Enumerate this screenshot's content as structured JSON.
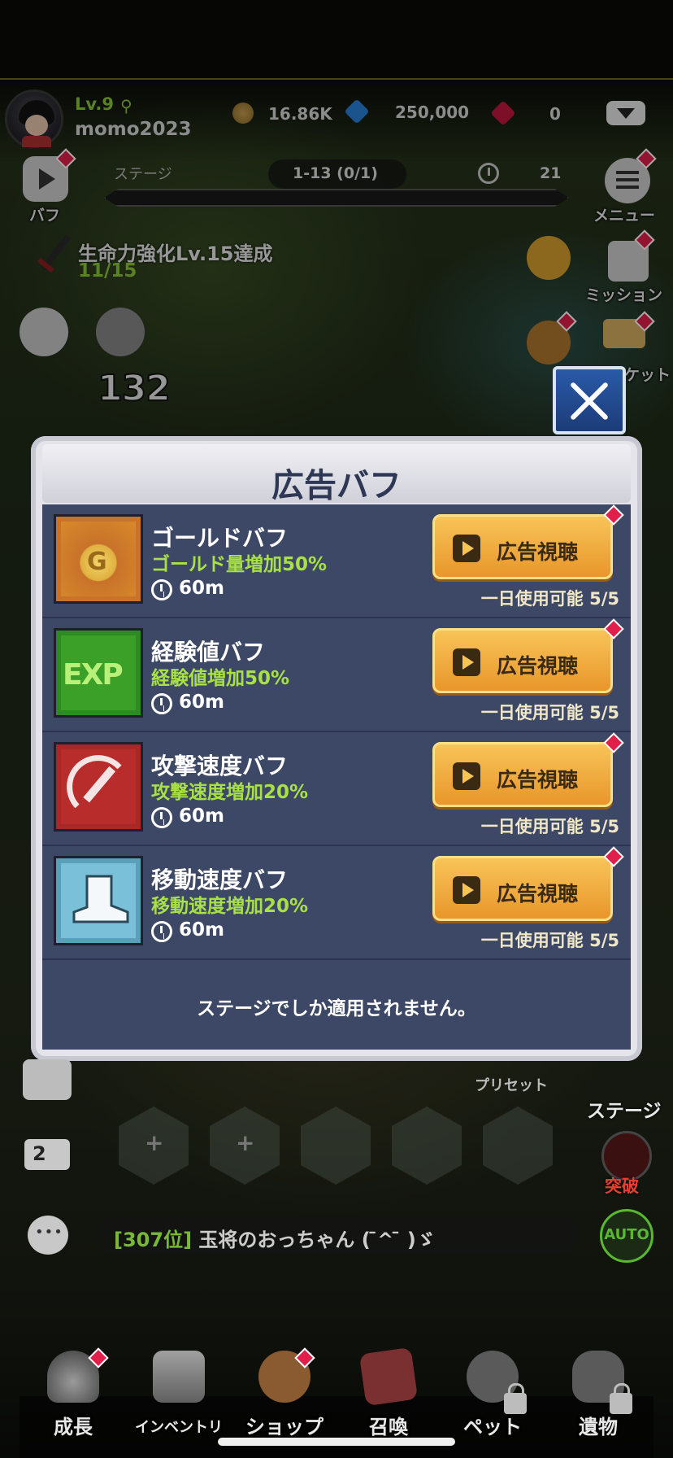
{
  "player": {
    "level": "Lv.9",
    "name": "momo2023"
  },
  "currency": {
    "gold": "16.86K",
    "diamonds": "250,000",
    "rubies": "0"
  },
  "left_menu": {
    "buff_label": "バフ"
  },
  "right_menu": {
    "menu_label": "メニュー",
    "mission_label": "ミッション",
    "ticket_label": "ケット"
  },
  "stage": {
    "label": "ステージ",
    "progress": "1-13  (0/1)",
    "timer": "21"
  },
  "quest": {
    "title": "生命力強化Lv.15達成",
    "progress": "11/15"
  },
  "power": "132",
  "modal": {
    "title": "広告バフ",
    "buffs": [
      {
        "name": "ゴールドバフ",
        "desc": "ゴールド量増加50%",
        "duration": "60m",
        "button": "広告視聴",
        "limit": "一日使用可能 5/5",
        "icon": "gold-coin-icon",
        "color": "#d88a2a"
      },
      {
        "name": "経験値バフ",
        "desc": "経験値増加50%",
        "duration": "60m",
        "button": "広告視聴",
        "limit": "一日使用可能 5/5",
        "icon": "exp-icon",
        "color": "#3aa028"
      },
      {
        "name": "攻撃速度バフ",
        "desc": "攻撃速度増加20%",
        "duration": "60m",
        "button": "広告視聴",
        "limit": "一日使用可能 5/5",
        "icon": "attack-speed-icon",
        "color": "#b82c2c"
      },
      {
        "name": "移動速度バフ",
        "desc": "移動速度増加20%",
        "duration": "60m",
        "button": "広告視聴",
        "limit": "一日使用可能 5/5",
        "icon": "boot-icon",
        "color": "#6ab0c8"
      }
    ],
    "notice": "ステージでしか適用されません。"
  },
  "lower": {
    "preset_label": "プリセット",
    "stage_label": "ステージ",
    "breakthrough_label": "突破",
    "auto_label": "AUTO"
  },
  "chat": {
    "rank": "[307位]",
    "message": " 玉将のおっちゃん (  ̄^ ̄ )ゞ"
  },
  "nav": {
    "growth": "成長",
    "inventory": "インベントリ",
    "shop": "ショップ",
    "summon": "召喚",
    "pet": "ペット",
    "relic": "遺物"
  }
}
